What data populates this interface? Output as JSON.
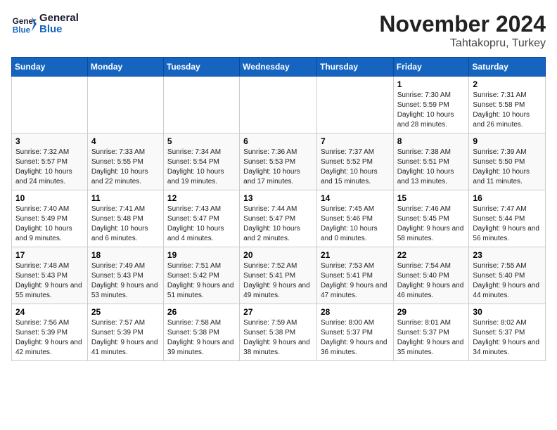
{
  "header": {
    "logo": {
      "line1": "General",
      "line2": "Blue"
    },
    "title": "November 2024",
    "location": "Tahtakopru, Turkey"
  },
  "weekdays": [
    "Sunday",
    "Monday",
    "Tuesday",
    "Wednesday",
    "Thursday",
    "Friday",
    "Saturday"
  ],
  "weeks": [
    [
      {
        "day": "",
        "info": ""
      },
      {
        "day": "",
        "info": ""
      },
      {
        "day": "",
        "info": ""
      },
      {
        "day": "",
        "info": ""
      },
      {
        "day": "",
        "info": ""
      },
      {
        "day": "1",
        "info": "Sunrise: 7:30 AM\nSunset: 5:59 PM\nDaylight: 10 hours and 28 minutes."
      },
      {
        "day": "2",
        "info": "Sunrise: 7:31 AM\nSunset: 5:58 PM\nDaylight: 10 hours and 26 minutes."
      }
    ],
    [
      {
        "day": "3",
        "info": "Sunrise: 7:32 AM\nSunset: 5:57 PM\nDaylight: 10 hours and 24 minutes."
      },
      {
        "day": "4",
        "info": "Sunrise: 7:33 AM\nSunset: 5:55 PM\nDaylight: 10 hours and 22 minutes."
      },
      {
        "day": "5",
        "info": "Sunrise: 7:34 AM\nSunset: 5:54 PM\nDaylight: 10 hours and 19 minutes."
      },
      {
        "day": "6",
        "info": "Sunrise: 7:36 AM\nSunset: 5:53 PM\nDaylight: 10 hours and 17 minutes."
      },
      {
        "day": "7",
        "info": "Sunrise: 7:37 AM\nSunset: 5:52 PM\nDaylight: 10 hours and 15 minutes."
      },
      {
        "day": "8",
        "info": "Sunrise: 7:38 AM\nSunset: 5:51 PM\nDaylight: 10 hours and 13 minutes."
      },
      {
        "day": "9",
        "info": "Sunrise: 7:39 AM\nSunset: 5:50 PM\nDaylight: 10 hours and 11 minutes."
      }
    ],
    [
      {
        "day": "10",
        "info": "Sunrise: 7:40 AM\nSunset: 5:49 PM\nDaylight: 10 hours and 9 minutes."
      },
      {
        "day": "11",
        "info": "Sunrise: 7:41 AM\nSunset: 5:48 PM\nDaylight: 10 hours and 6 minutes."
      },
      {
        "day": "12",
        "info": "Sunrise: 7:43 AM\nSunset: 5:47 PM\nDaylight: 10 hours and 4 minutes."
      },
      {
        "day": "13",
        "info": "Sunrise: 7:44 AM\nSunset: 5:47 PM\nDaylight: 10 hours and 2 minutes."
      },
      {
        "day": "14",
        "info": "Sunrise: 7:45 AM\nSunset: 5:46 PM\nDaylight: 10 hours and 0 minutes."
      },
      {
        "day": "15",
        "info": "Sunrise: 7:46 AM\nSunset: 5:45 PM\nDaylight: 9 hours and 58 minutes."
      },
      {
        "day": "16",
        "info": "Sunrise: 7:47 AM\nSunset: 5:44 PM\nDaylight: 9 hours and 56 minutes."
      }
    ],
    [
      {
        "day": "17",
        "info": "Sunrise: 7:48 AM\nSunset: 5:43 PM\nDaylight: 9 hours and 55 minutes."
      },
      {
        "day": "18",
        "info": "Sunrise: 7:49 AM\nSunset: 5:43 PM\nDaylight: 9 hours and 53 minutes."
      },
      {
        "day": "19",
        "info": "Sunrise: 7:51 AM\nSunset: 5:42 PM\nDaylight: 9 hours and 51 minutes."
      },
      {
        "day": "20",
        "info": "Sunrise: 7:52 AM\nSunset: 5:41 PM\nDaylight: 9 hours and 49 minutes."
      },
      {
        "day": "21",
        "info": "Sunrise: 7:53 AM\nSunset: 5:41 PM\nDaylight: 9 hours and 47 minutes."
      },
      {
        "day": "22",
        "info": "Sunrise: 7:54 AM\nSunset: 5:40 PM\nDaylight: 9 hours and 46 minutes."
      },
      {
        "day": "23",
        "info": "Sunrise: 7:55 AM\nSunset: 5:40 PM\nDaylight: 9 hours and 44 minutes."
      }
    ],
    [
      {
        "day": "24",
        "info": "Sunrise: 7:56 AM\nSunset: 5:39 PM\nDaylight: 9 hours and 42 minutes."
      },
      {
        "day": "25",
        "info": "Sunrise: 7:57 AM\nSunset: 5:39 PM\nDaylight: 9 hours and 41 minutes."
      },
      {
        "day": "26",
        "info": "Sunrise: 7:58 AM\nSunset: 5:38 PM\nDaylight: 9 hours and 39 minutes."
      },
      {
        "day": "27",
        "info": "Sunrise: 7:59 AM\nSunset: 5:38 PM\nDaylight: 9 hours and 38 minutes."
      },
      {
        "day": "28",
        "info": "Sunrise: 8:00 AM\nSunset: 5:37 PM\nDaylight: 9 hours and 36 minutes."
      },
      {
        "day": "29",
        "info": "Sunrise: 8:01 AM\nSunset: 5:37 PM\nDaylight: 9 hours and 35 minutes."
      },
      {
        "day": "30",
        "info": "Sunrise: 8:02 AM\nSunset: 5:37 PM\nDaylight: 9 hours and 34 minutes."
      }
    ]
  ]
}
